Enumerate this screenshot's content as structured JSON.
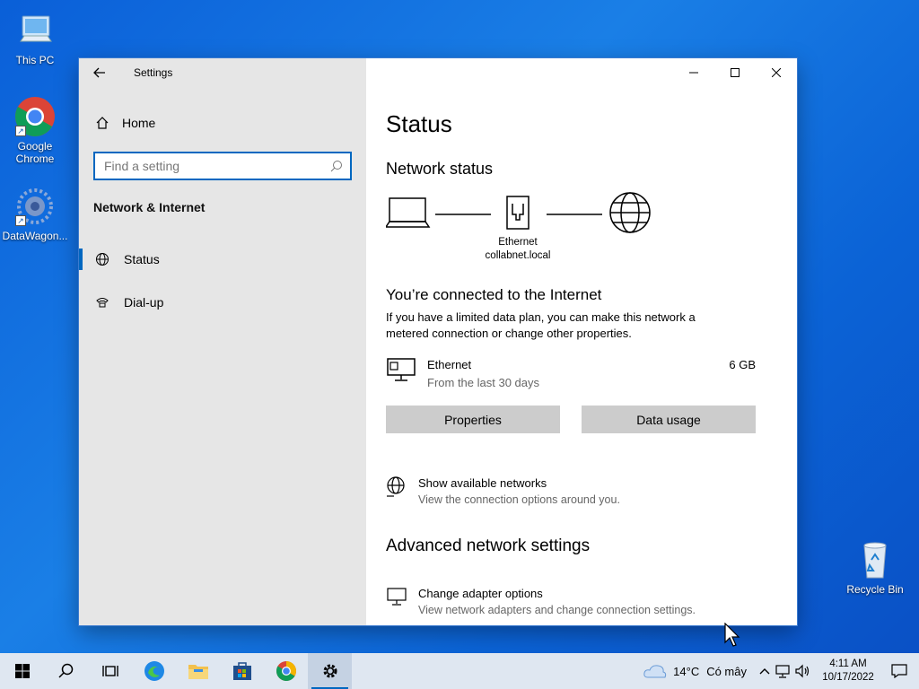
{
  "desktop": {
    "icons": [
      {
        "label": "This PC"
      },
      {
        "label": "Google Chrome"
      },
      {
        "label": "DataWagon..."
      },
      {
        "label": "Recycle Bin"
      }
    ]
  },
  "window": {
    "title": "Settings",
    "sidebar": {
      "home_label": "Home",
      "search_placeholder": "Find a setting",
      "section_label": "Network & Internet",
      "items": [
        {
          "label": "Status",
          "icon": "globe-icon",
          "active": true
        },
        {
          "label": "Dial-up",
          "icon": "dialup-icon",
          "active": false
        }
      ]
    },
    "main": {
      "page_title": "Status",
      "network_status_heading": "Network status",
      "diagram": {
        "adapter_name": "Ethernet",
        "domain": "collabnet.local"
      },
      "connected_title": "You’re connected to the Internet",
      "connected_desc": "If you have a limited data plan, you can make this network a metered connection or change other properties.",
      "connection": {
        "name": "Ethernet",
        "period": "From the last 30 days",
        "usage": "6 GB"
      },
      "buttons": {
        "properties": "Properties",
        "data_usage": "Data usage"
      },
      "show_networks": {
        "title": "Show available networks",
        "desc": "View the connection options around you."
      },
      "advanced_heading": "Advanced network settings",
      "adapter_options": {
        "title": "Change adapter options",
        "desc": "View network adapters and change connection settings."
      }
    }
  },
  "taskbar": {
    "weather_temp": "14°C",
    "weather_text": "Có mây",
    "time": "4:11 AM",
    "date": "10/17/2022"
  },
  "colors": {
    "accent": "#0067c0",
    "desktop": "#0a5fd8",
    "sidebar": "#e6e6e6"
  }
}
